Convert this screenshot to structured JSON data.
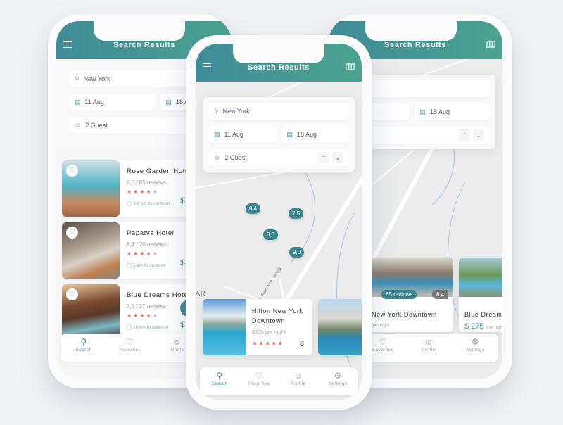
{
  "app": {
    "title": "Search Results",
    "brand_color": "#3f8c98",
    "accent_color_2": "#4aa38e",
    "star_color": "#e26a55"
  },
  "search": {
    "location": "New York",
    "check_in": "11 Aug",
    "check_out": "18 Aug",
    "guests": "2 Guest"
  },
  "icons": {
    "menu": "menu-icon",
    "map": "map-icon",
    "search": "search-icon",
    "calendar": "calendar-icon",
    "user": "user-icon",
    "chevron_up": "chevron-up-icon",
    "chevron_down": "chevron-down-icon",
    "heart": "heart-icon",
    "pin": "location-pin-icon",
    "settings": "gear-icon"
  },
  "list_hotels": [
    {
      "name": "Rose Garden Hotel",
      "rating_text": "8,6 / 85 reviews",
      "stars": 4,
      "distance": "3,2 km to centrum",
      "price": "$"
    },
    {
      "name": "Papatya Hotel",
      "rating_text": "8,4 / 70 reviews",
      "stars": 4,
      "distance": "5 km to centrum",
      "price": "$"
    },
    {
      "name": "Blue Dreams Hotel",
      "rating_text": "7,5 / 37 reviews",
      "stars": 4,
      "distance": "10 km to centrum",
      "price": "$"
    }
  ],
  "map_pins": [
    "8,4",
    "7,5",
    "8,0",
    "9,0"
  ],
  "map_labels": {
    "street": "Jl. Raya Yeh Gangga",
    "area": "AR"
  },
  "map_card": {
    "name": "Hilton New York Downtown",
    "price": "$105 per night",
    "stars": 5,
    "score": "8"
  },
  "right_cards": [
    {
      "name": "New York Downtown",
      "reviews": "85 reviews",
      "score": "8,4",
      "price": "",
      "per": "/per night"
    },
    {
      "name": "Blue Dreams",
      "price": "$ 275",
      "per": "/per night"
    }
  ],
  "tabs": [
    {
      "label": "Search",
      "active": true
    },
    {
      "label": "Favorites",
      "active": false
    },
    {
      "label": "Profile",
      "active": false
    },
    {
      "label": "Settings",
      "active": false
    }
  ]
}
